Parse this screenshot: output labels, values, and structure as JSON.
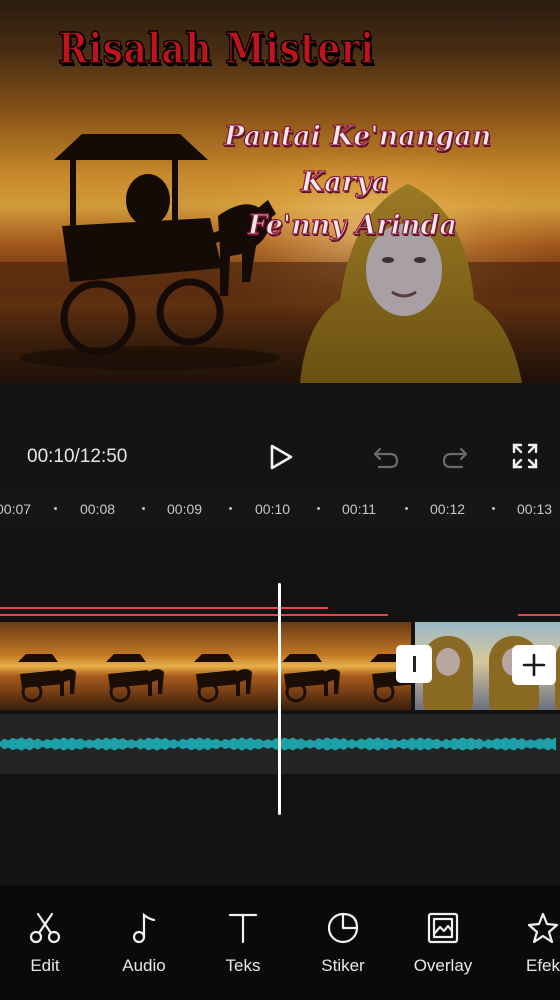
{
  "preview": {
    "overlay_title": "Risalah Misteri",
    "story_title_lines": [
      "Pantai Ke'nangan",
      "Karya",
      "Fe'nny Arinda"
    ],
    "overlay_clip_description": "Overlay"
  },
  "player": {
    "timecode": "00:10/12:50",
    "controls": [
      "play-icon",
      "undo-icon",
      "redo-icon",
      "fullscreen-icon"
    ]
  },
  "ruler": {
    "ticks": [
      "00:07",
      "00:08",
      "00:09",
      "00:10",
      "00:11",
      "00:12",
      "00:13"
    ]
  },
  "timeline": {
    "current_time": "00:10",
    "add_clip_icon": "plus-icon"
  },
  "toolbar": {
    "items": [
      {
        "label": "Edit",
        "icon": "scissors-icon"
      },
      {
        "label": "Audio",
        "icon": "music-note-icon"
      },
      {
        "label": "Teks",
        "icon": "text-t-icon"
      },
      {
        "label": "Stiker",
        "icon": "sticker-icon"
      },
      {
        "label": "Overlay",
        "icon": "overlay-image-icon"
      },
      {
        "label": "Efek",
        "icon": "effects-star-icon"
      }
    ]
  },
  "colors": {
    "background": "#141414",
    "toolbar": "#0a0a0a",
    "accent_red": "#e0474c",
    "waveform": "#1ea0a8",
    "playhead": "#ffffff"
  }
}
